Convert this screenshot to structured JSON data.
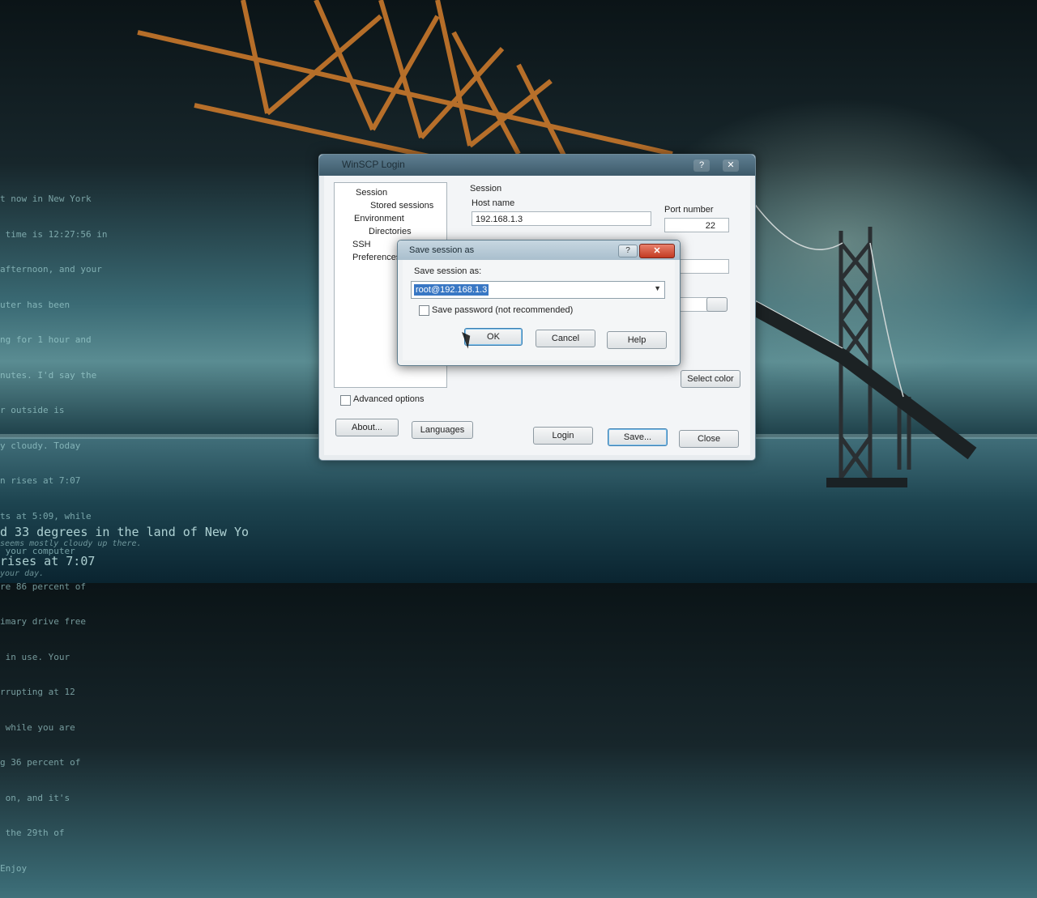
{
  "desktop": {
    "side_text": [
      "t now in New York",
      " time is 12:27:56 in",
      "afternoon, and your",
      "uter has been",
      "ng for 1 hour and",
      "nutes. I'd say the",
      "r outside is",
      "y cloudy. Today",
      "n rises at 7:07",
      "ts at 5:09, while",
      " your computer",
      "re 86 percent of",
      "imary drive free",
      " in use. Your",
      "rrupting at 12",
      " while you are",
      "g 36 percent of",
      " on, and it's",
      " the 29th of",
      "Enjoy"
    ],
    "bottom_lines": [
      "d 33 degrees in the land of New Yo",
      "  seems mostly cloudy up there.",
      "rises at 7:07",
      "  your day."
    ]
  },
  "main_window": {
    "title": "WinSCP Login",
    "help_glyph": "?",
    "close_glyph": "✕",
    "tree": [
      "Session",
      "Stored sessions",
      "Environment",
      "Directories",
      "SSH",
      "Preferences"
    ],
    "session_header": "Session",
    "host_label": "Host name",
    "host_value": "192.168.1.3",
    "port_label": "Port number",
    "port_value": "22",
    "advanced_options": "Advanced options",
    "select_color": "Select color",
    "buttons": {
      "about": "About...",
      "languages": "Languages",
      "login": "Login",
      "save": "Save...",
      "close": "Close"
    }
  },
  "dialog": {
    "title": "Save session as",
    "help_glyph": "?",
    "close_glyph": "✕",
    "field_label": "Save session as:",
    "field_value": "root@192.168.1.3",
    "save_password": "Save password (not recommended)",
    "ok": "OK",
    "cancel": "Cancel",
    "help": "Help",
    "dropdown_arrow": "▼"
  },
  "icons": {
    "cursor": "mouse-pointer-icon"
  }
}
